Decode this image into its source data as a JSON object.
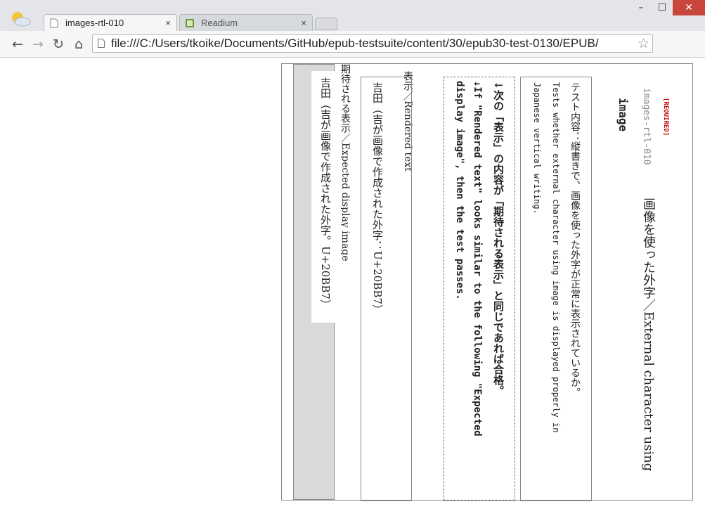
{
  "browser": {
    "tabs": [
      {
        "label": "images-rtl-010",
        "active": true
      },
      {
        "label": "Readium",
        "active": false
      }
    ],
    "close_glyph": "×",
    "url": "file:///C:/Users/tkoike/Documents/GitHub/epub-testsuite/content/30/epub30-test-0130/EPUB/",
    "window_controls": {
      "minimize": "–",
      "maximize": "☐",
      "close": "✕"
    },
    "nav": {
      "back": "←",
      "forward": "→",
      "reload": "↻",
      "home": "⌂",
      "star": "☆"
    }
  },
  "page": {
    "required_badge": "[REQUIRED]",
    "test_id": "images-rtl-010",
    "title_main": "画像を使った外字／External character using",
    "title_en_cont": "image",
    "description": {
      "ja": "テスト内容：縦書きで、画像を使った外字が正常に表示されているか。",
      "en_line1": "Tests whether external character using image is displayed properly in",
      "en_line2": "Japanese vertical writing."
    },
    "instructions": {
      "line1": "↓次の「表示」の内容が「期待される表示」と同じであれば合格。",
      "line2": "↓If \"Rendered text\" looks similar to the following \"Expected",
      "line3": "display image\", then the test passes."
    },
    "rendered": {
      "label": "表示／Rendered text",
      "text": "吉田（吉が画像で作成された外字：U+20BB7）"
    },
    "expected": {
      "label": "期待される表示／Expected display image",
      "text": "吉田（吉が画像で作成された外字。U+20BB7）"
    }
  },
  "colors": {
    "required": "#cc0000",
    "close_button": "#c9463d",
    "expected_background": "#d9d9d9"
  }
}
